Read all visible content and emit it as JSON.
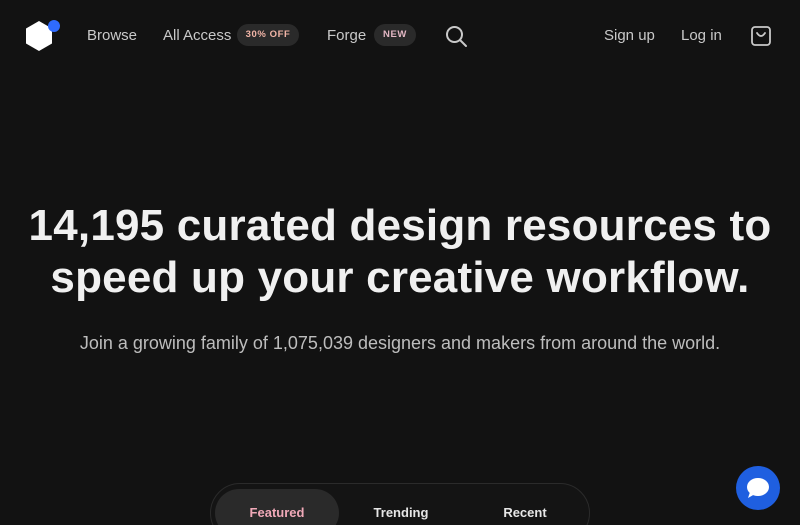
{
  "nav": {
    "logo": "logo-icon",
    "browse": "Browse",
    "all_access": "All Access",
    "all_access_badge": "30% OFF",
    "forge": "Forge",
    "forge_badge": "NEW",
    "search_icon": "search-icon",
    "sign_up": "Sign up",
    "log_in": "Log in",
    "cart_icon": "shopping-bag-icon"
  },
  "hero": {
    "title_line1": "14,195 curated design resources to",
    "title_line2": "speed up your creative workflow.",
    "subtitle": "Join a growing family of 1,075,039 designers and makers from around the world."
  },
  "tabs": [
    {
      "label": "Featured",
      "active": true
    },
    {
      "label": "Trending",
      "active": false
    },
    {
      "label": "Recent",
      "active": false
    }
  ],
  "chat": {
    "icon": "chat-bubble-icon"
  },
  "colors": {
    "background": "#121212",
    "logo_dot": "#2f6bff",
    "chat_button": "#1f5fe0",
    "badge_off_text": "#f2b5a7",
    "badge_new_text": "#e3b7c4",
    "active_tab_text": "#f0a9b8"
  }
}
